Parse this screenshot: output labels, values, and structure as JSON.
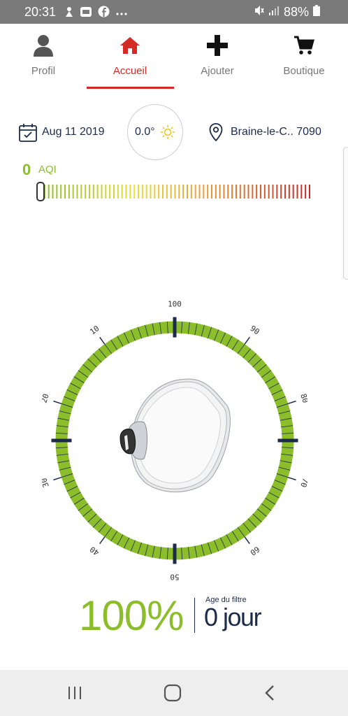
{
  "status_bar": {
    "time": "20:31",
    "battery": "88%",
    "left_icons": [
      "notification-icon",
      "app-icon",
      "facebook-icon",
      "more-dots-icon"
    ],
    "right_icons": [
      "mute-icon",
      "signal-icon",
      "battery-icon"
    ]
  },
  "tabs": [
    {
      "label": "Profil",
      "icon": "person-icon",
      "active": false
    },
    {
      "label": "Accueil",
      "icon": "home-icon",
      "active": true
    },
    {
      "label": "Ajouter",
      "icon": "plus-icon",
      "active": false
    },
    {
      "label": "Boutique",
      "icon": "cart-icon",
      "active": false
    }
  ],
  "info": {
    "date": "Aug 11 2019",
    "temperature": "0.0°",
    "location": "Braine-le-C.. 7090"
  },
  "aqi": {
    "value": "0",
    "unit": "AQI",
    "level": 0
  },
  "gauge": {
    "labels": [
      "100",
      "90",
      "80",
      "70",
      "60",
      "50",
      "40",
      "30",
      "20",
      "10"
    ],
    "filter_fraction": 1.0,
    "colors": {
      "track": "#8cbd2b",
      "ticks": "#1c2b4a"
    }
  },
  "filter": {
    "percent": "100%",
    "age_label": "Age du filtre",
    "age_value": "0 jour"
  },
  "colors": {
    "accent": "#d42a25",
    "green": "#8cbd2b",
    "navy": "#1c2b4a"
  }
}
